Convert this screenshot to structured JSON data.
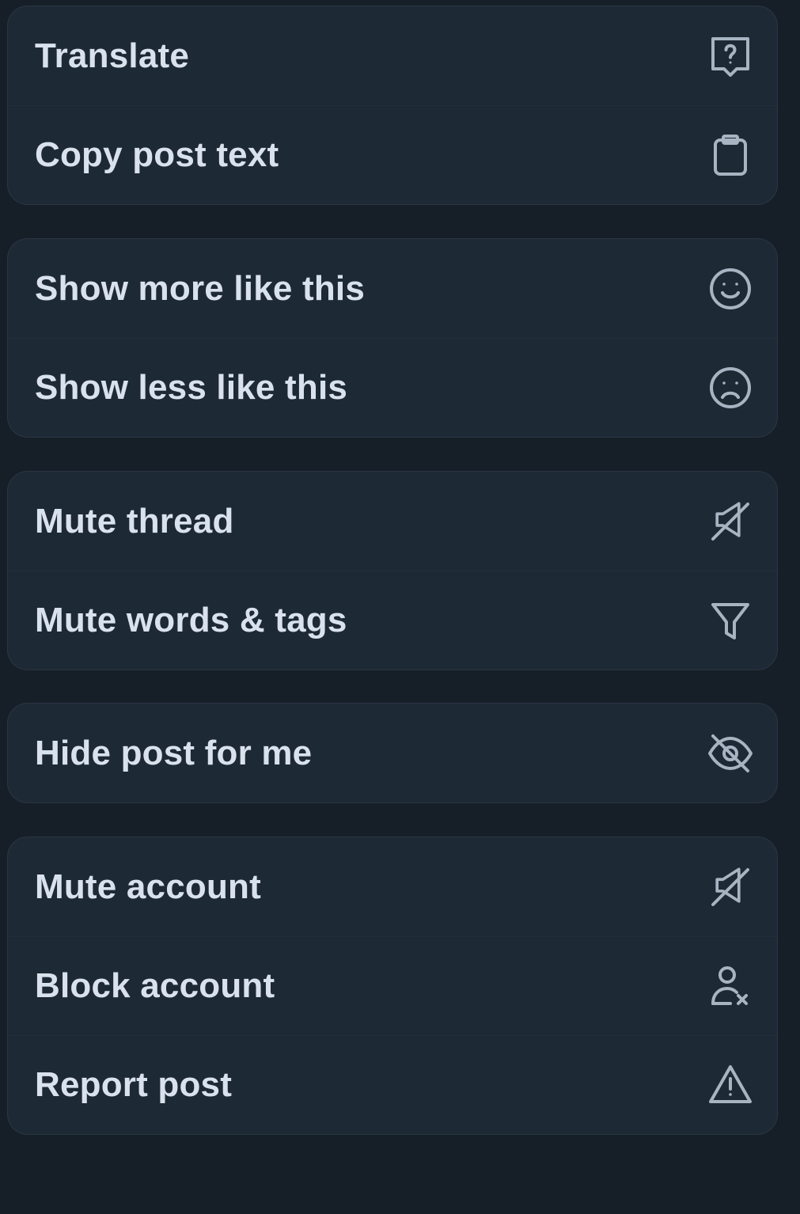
{
  "menu": {
    "groups": [
      {
        "items": [
          {
            "label": "Translate",
            "icon": "translate-bubble-question-icon"
          },
          {
            "label": "Copy post text",
            "icon": "clipboard-icon"
          }
        ]
      },
      {
        "items": [
          {
            "label": "Show more like this",
            "icon": "smile-icon"
          },
          {
            "label": "Show less like this",
            "icon": "frown-icon"
          }
        ]
      },
      {
        "items": [
          {
            "label": "Mute thread",
            "icon": "speaker-muted-icon"
          },
          {
            "label": "Mute words & tags",
            "icon": "filter-funnel-icon"
          }
        ]
      },
      {
        "items": [
          {
            "label": "Hide post for me",
            "icon": "eye-slash-icon"
          }
        ]
      },
      {
        "items": [
          {
            "label": "Mute account",
            "icon": "speaker-muted-icon"
          },
          {
            "label": "Block account",
            "icon": "person-x-icon"
          },
          {
            "label": "Report post",
            "icon": "warning-triangle-icon"
          }
        ]
      }
    ]
  },
  "colors": {
    "background": "#161e27",
    "group_background": "#1e2936",
    "text": "#d9e2ec",
    "icon": "#a7b4c2"
  }
}
